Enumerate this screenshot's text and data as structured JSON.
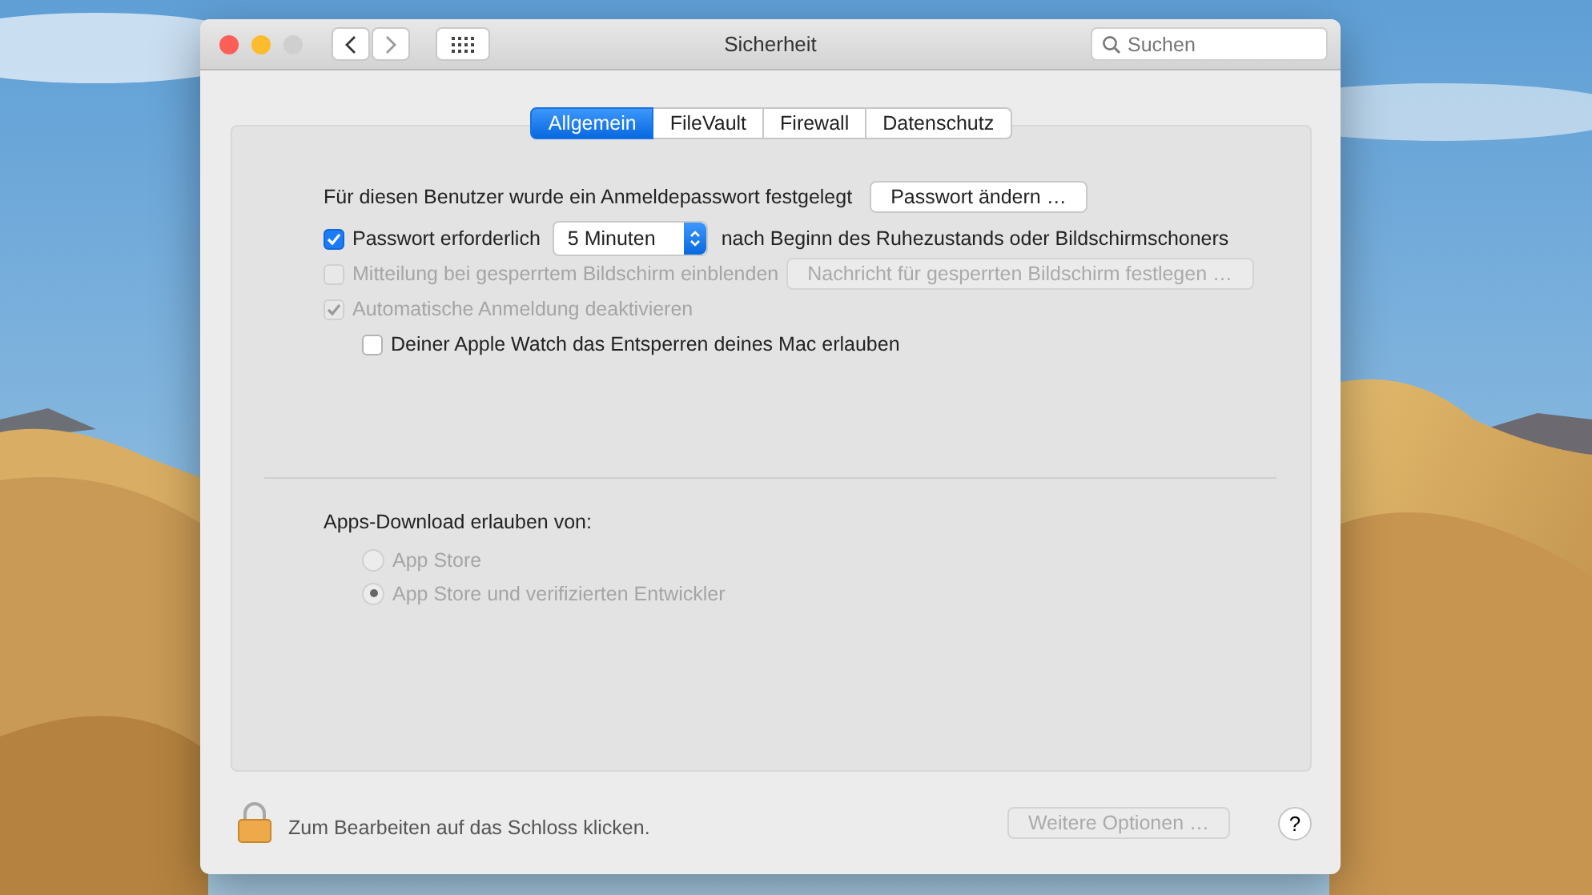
{
  "window": {
    "title": "Sicherheit"
  },
  "search": {
    "placeholder": "Suchen"
  },
  "tabs": [
    {
      "label": "Allgemein",
      "selected": true
    },
    {
      "label": "FileVault",
      "selected": false
    },
    {
      "label": "Firewall",
      "selected": false
    },
    {
      "label": "Datenschutz",
      "selected": false
    }
  ],
  "password_row": {
    "label": "Für diesen Benutzer wurde ein Anmeldepasswort festgelegt",
    "button": "Passwort ändern …"
  },
  "require_password": {
    "label": "Passwort erforderlich",
    "checked": true,
    "disabled": false,
    "delay": "5 Minuten",
    "suffix": "nach Beginn des Ruhezustands oder Bildschirmschoners"
  },
  "lock_message": {
    "label": "Mitteilung bei gesperrtem Bildschirm einblenden",
    "checked": false,
    "disabled": true,
    "button": "Nachricht für gesperrten Bildschirm festlegen …"
  },
  "auto_login": {
    "label": "Automatische Anmeldung deaktivieren",
    "checked": true,
    "disabled": true
  },
  "apple_watch": {
    "label": "Deiner Apple Watch das Entsperren deines Mac erlauben",
    "checked": false,
    "disabled": false
  },
  "downloads": {
    "label": "Apps-Download erlauben von:",
    "options": [
      {
        "label": "App Store",
        "selected": false,
        "disabled": true
      },
      {
        "label": "App Store und verifizierten Entwickler",
        "selected": true,
        "disabled": true
      }
    ]
  },
  "footer": {
    "lock_text": "Zum Bearbeiten auf das Schloss klicken.",
    "button": "Weitere Optionen …",
    "button_disabled": true,
    "help": "?"
  }
}
